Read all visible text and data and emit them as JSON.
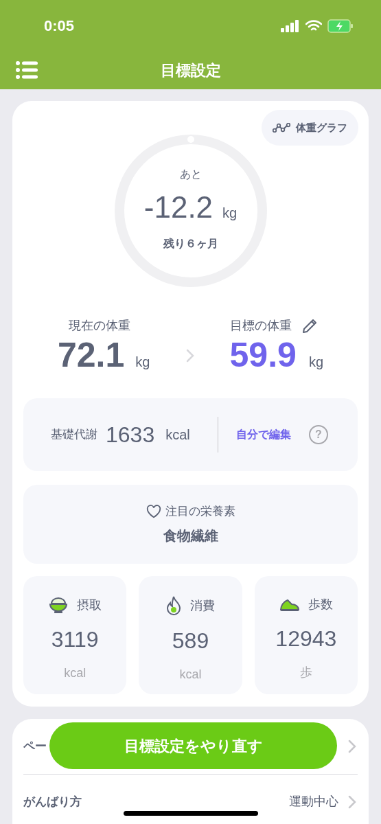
{
  "status_bar": {
    "time": "0:05"
  },
  "header": {
    "title": "目標設定"
  },
  "graph_button": {
    "label": "体重グラフ"
  },
  "remaining": {
    "caption": "あと",
    "value": "-12.2",
    "unit": "kg",
    "period": "残り６ヶ月",
    "level": 0
  },
  "current_weight": {
    "label": "現在の体重",
    "value": "72.1",
    "unit": "kg"
  },
  "target_weight": {
    "label": "目標の体重",
    "value": "59.9",
    "unit": "kg"
  },
  "bmr": {
    "label": "基礎代謝",
    "value": "1633",
    "unit": "kcal",
    "edit_link": "自分で編集",
    "help": "?"
  },
  "nutrient": {
    "label": "注目の栄養素",
    "value": "食物繊維"
  },
  "stats": [
    {
      "kind": "intake",
      "label": "摂取",
      "value": "3119",
      "unit": "kcal"
    },
    {
      "kind": "burned",
      "label": "消費",
      "value": "589",
      "unit": "kcal"
    },
    {
      "kind": "steps",
      "label": "歩数",
      "value": "12943",
      "unit": "歩"
    }
  ],
  "settings": [
    {
      "label": "ペー"
    },
    {
      "label": "がんばり方",
      "value": "運動中心"
    }
  ],
  "redo_button": {
    "label": "目標設定をやり直す"
  }
}
